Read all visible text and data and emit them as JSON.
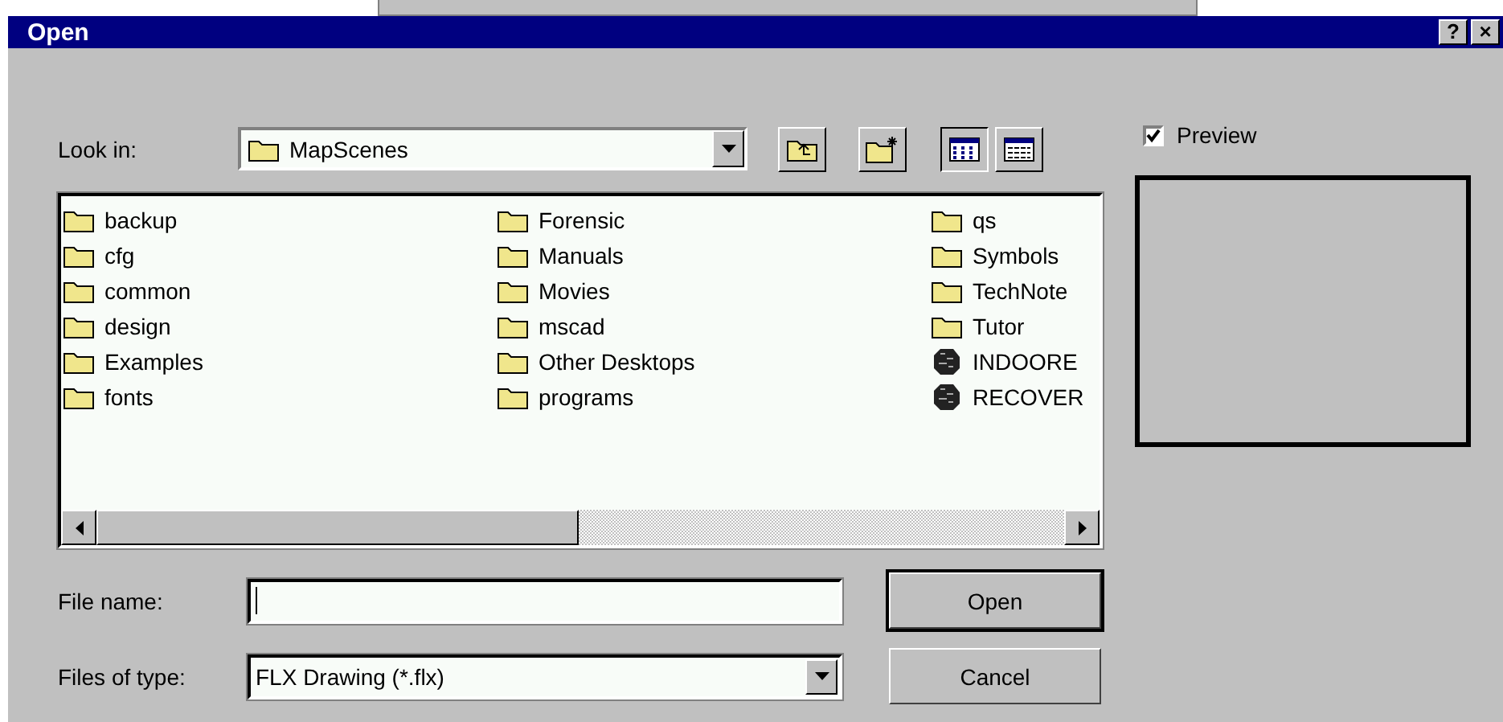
{
  "window": {
    "title": "Open",
    "title_buttons": [
      "?",
      "×"
    ]
  },
  "look_in": {
    "label": "Look in:",
    "value": "MapScenes"
  },
  "files": [
    {
      "name": "backup",
      "kind": "folder"
    },
    {
      "name": "cfg",
      "kind": "folder"
    },
    {
      "name": "common",
      "kind": "folder"
    },
    {
      "name": "design",
      "kind": "folder"
    },
    {
      "name": "Examples",
      "kind": "folder"
    },
    {
      "name": "fonts",
      "kind": "folder"
    },
    {
      "name": "Forensic",
      "kind": "folder"
    },
    {
      "name": "Manuals",
      "kind": "folder"
    },
    {
      "name": "Movies",
      "kind": "folder"
    },
    {
      "name": "mscad",
      "kind": "folder"
    },
    {
      "name": "Other Desktops",
      "kind": "folder"
    },
    {
      "name": "programs",
      "kind": "folder"
    },
    {
      "name": "qs",
      "kind": "folder"
    },
    {
      "name": "Symbols",
      "kind": "folder"
    },
    {
      "name": "TechNote",
      "kind": "folder"
    },
    {
      "name": "Tutor",
      "kind": "folder"
    },
    {
      "name": "INDOORE",
      "kind": "file"
    },
    {
      "name": "RECOVER",
      "kind": "file"
    }
  ],
  "file_name": {
    "label": "File name:"
  },
  "files_of_type": {
    "label": "Files of type:",
    "value": "FLX Drawing (*.flx)"
  },
  "buttons": [
    {
      "label": "Open",
      "default": true
    },
    {
      "label": "Cancel",
      "default": false
    }
  ],
  "preview": {
    "label": "Preview",
    "checked": true
  }
}
